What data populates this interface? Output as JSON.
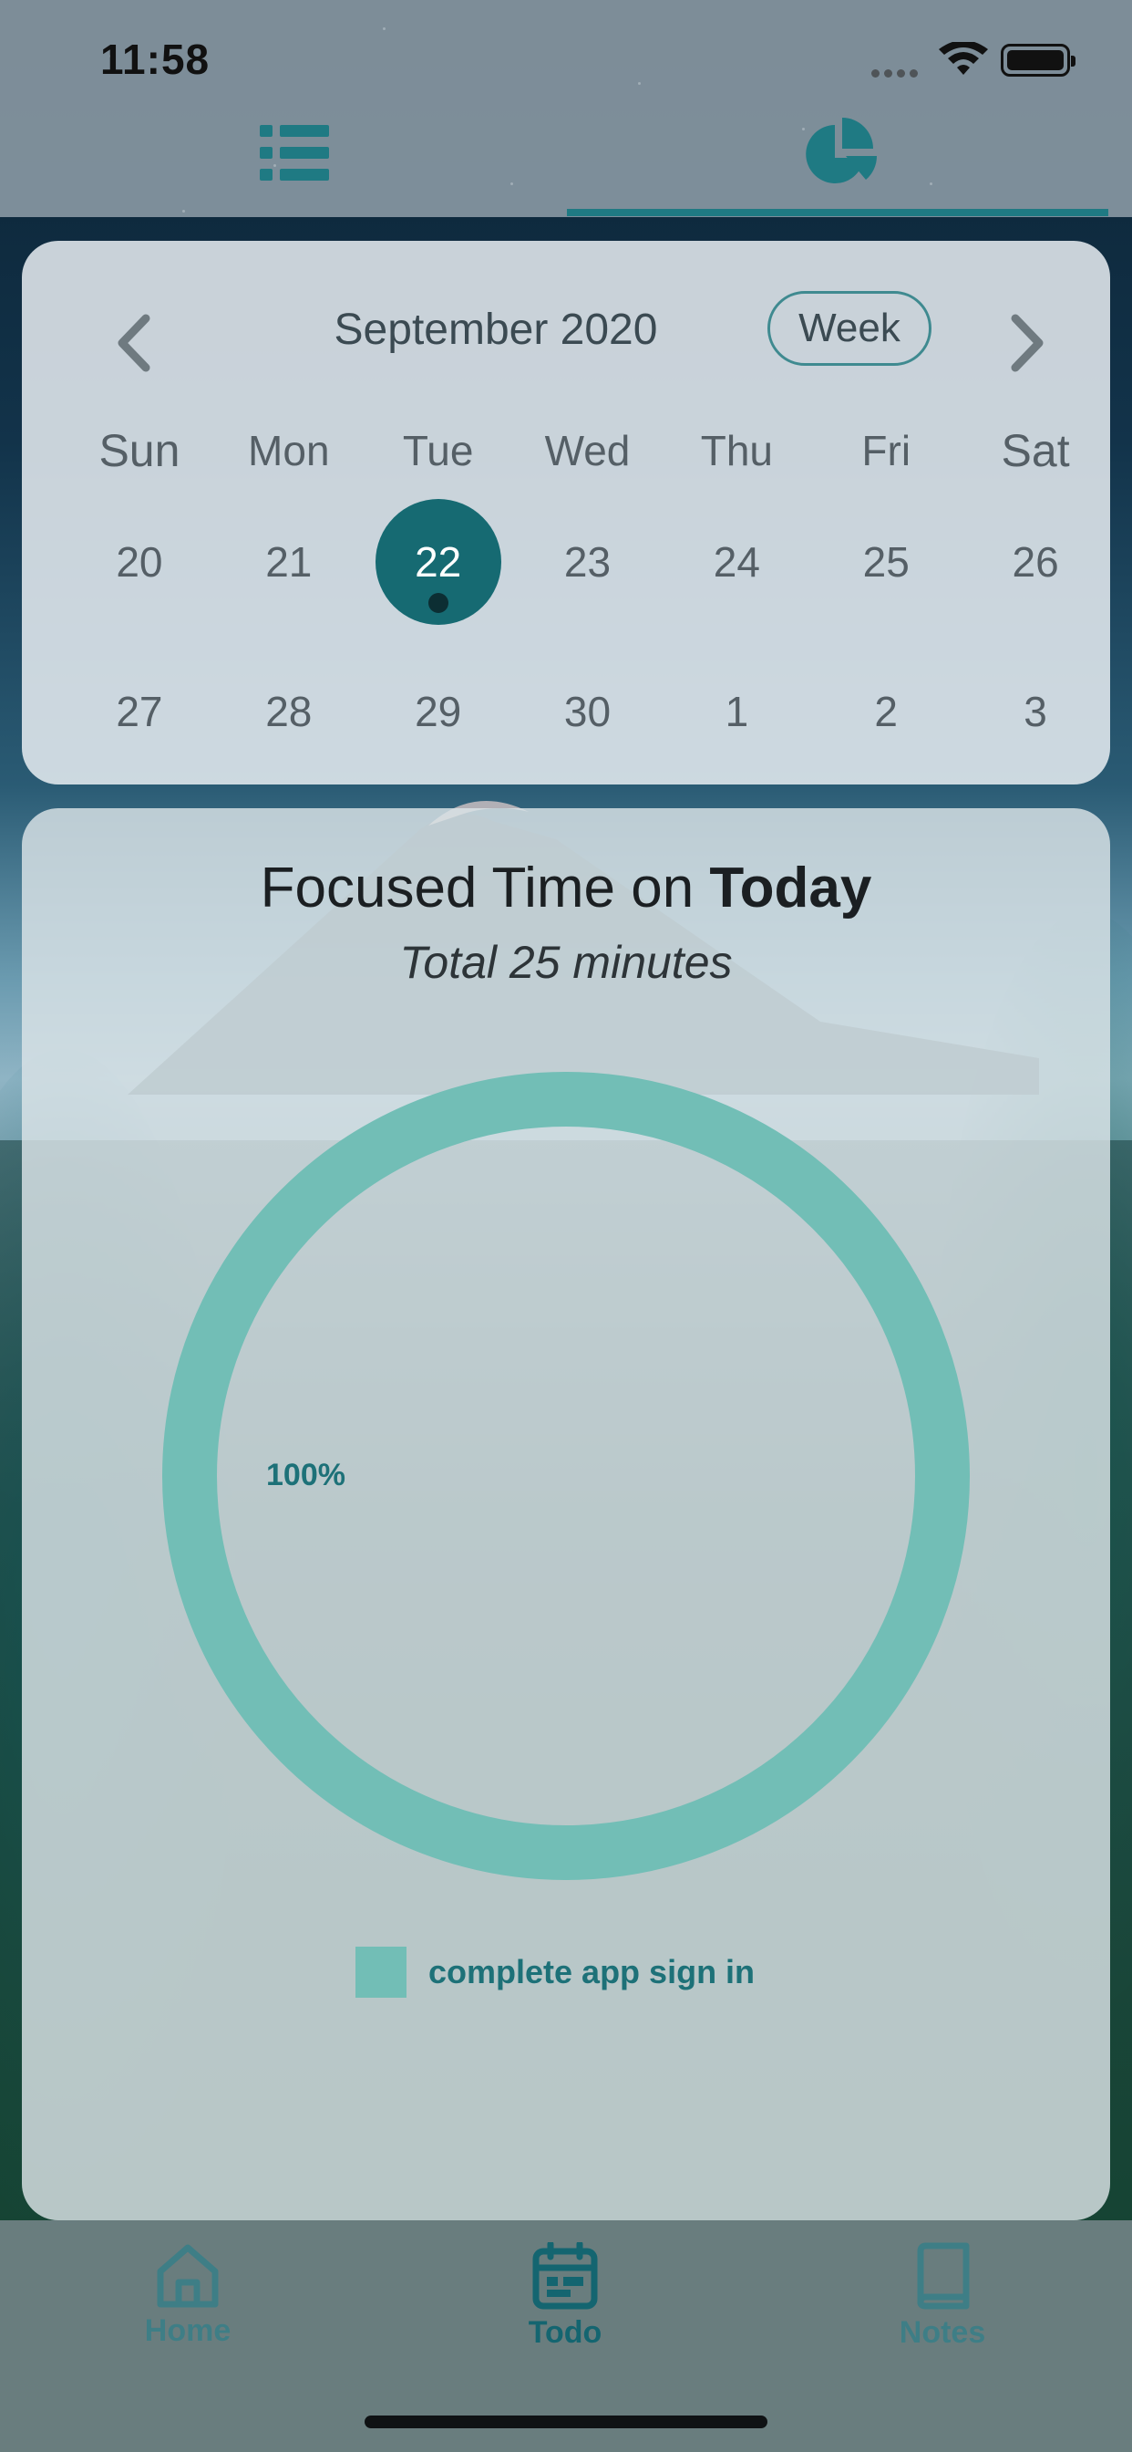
{
  "status_bar": {
    "time": "11:58"
  },
  "top_tabs": [
    {
      "icon": "list-icon",
      "selected": false
    },
    {
      "icon": "pie-chart-icon",
      "selected": true
    }
  ],
  "calendar": {
    "month_title": "September 2020",
    "view_toggle_label": "Week",
    "weekdays": [
      "Sun",
      "Mon",
      "Tue",
      "Wed",
      "Thu",
      "Fri",
      "Sat"
    ],
    "weeks": [
      [
        "20",
        "21",
        "22",
        "23",
        "24",
        "25",
        "26"
      ],
      [
        "27",
        "28",
        "29",
        "30",
        "1",
        "2",
        "3"
      ]
    ],
    "selected_day": "22",
    "colors": {
      "selected": "#166a72",
      "weekend": "#e3552e"
    }
  },
  "focus": {
    "title_prefix": "Focused Time on ",
    "title_emphasis": "Today",
    "total": "Total 25 minutes"
  },
  "chart_data": {
    "type": "pie",
    "style": "donut",
    "categories": [
      "complete app sign in"
    ],
    "values": [
      100
    ],
    "slice_labels": [
      "100%"
    ],
    "colors": [
      "#72beb6"
    ],
    "legend": {
      "position": "bottom",
      "entries": [
        "complete app sign in"
      ]
    }
  },
  "bottom_nav": {
    "items": [
      {
        "label": "Home",
        "icon": "home-icon",
        "active": false
      },
      {
        "label": "Todo",
        "icon": "calendar-icon",
        "active": true
      },
      {
        "label": "Notes",
        "icon": "book-icon",
        "active": false
      }
    ]
  }
}
